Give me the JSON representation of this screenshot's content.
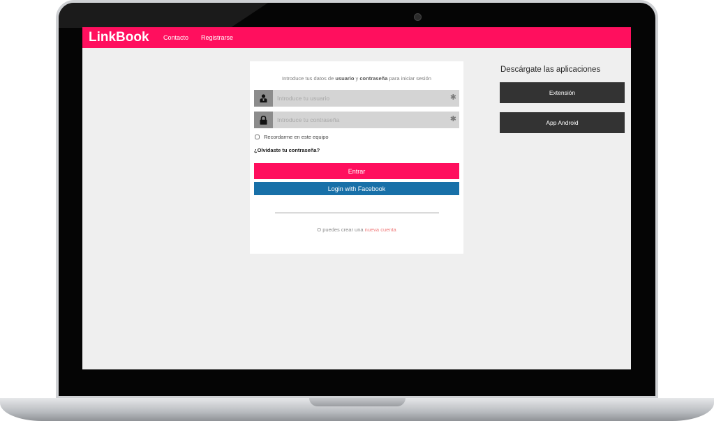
{
  "colors": {
    "brand_pink": "#ff0f5e",
    "facebook_blue": "#1870a8",
    "dark_button": "#333333",
    "page_background": "#efefef",
    "link_salmon": "#f07a7a"
  },
  "navbar": {
    "brand": "LinkBook",
    "links": [
      "Contacto",
      "Registrarse"
    ]
  },
  "login": {
    "intro": {
      "part1": "Introduce tus datos de ",
      "bold1": "usuario",
      "part2": " y ",
      "bold2": "contraseña",
      "part3": " para iniciar sesión"
    },
    "user_field": {
      "icon": "user-icon",
      "placeholder": "Introduce tu usuario",
      "value": "",
      "required_mark": "✱"
    },
    "password_field": {
      "icon": "lock-icon",
      "placeholder": "Introduce tu contraseña",
      "value": "",
      "required_mark": "✱"
    },
    "remember_label": "Recordarme en este equipo",
    "remember_checked": false,
    "forgot_link": "¿Olvidaste tu contraseña?",
    "submit_label": "Entrar",
    "facebook_label": "Login with Facebook",
    "create_text": "O puedes crear una ",
    "create_link": "nueva cuenta"
  },
  "apps": {
    "title": "Descárgate las aplicaciones",
    "buttons": [
      "Extensión",
      "App Android"
    ]
  }
}
